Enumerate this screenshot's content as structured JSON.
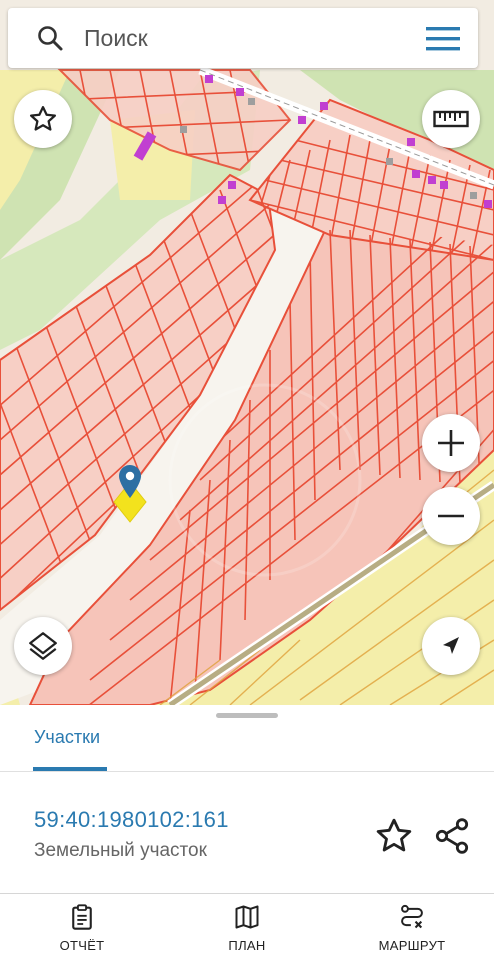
{
  "search": {
    "placeholder": "Поиск"
  },
  "map": {
    "icons": [
      "star-icon",
      "ruler-icon",
      "layers-icon",
      "zoom-in-icon",
      "zoom-out-icon",
      "locate-icon",
      "location-pin-icon"
    ],
    "colors": {
      "parcel_line": "#e8503a",
      "parcel_fill": "#f7c9bf",
      "forest": "#cfe3b2",
      "field": "#f4eeaa",
      "road": "#ffffff",
      "railway": "#a9a37a",
      "building": "#c13fd1"
    }
  },
  "sheet": {
    "tab_label": "Участки",
    "parcel_number": "59:40:1980102:161",
    "parcel_type": "Земельный участок"
  },
  "nav": {
    "report_label": "ОТЧЁТ",
    "plan_label": "ПЛАН",
    "route_label": "МАРШРУТ"
  },
  "accent_color": "#2a7ab0"
}
